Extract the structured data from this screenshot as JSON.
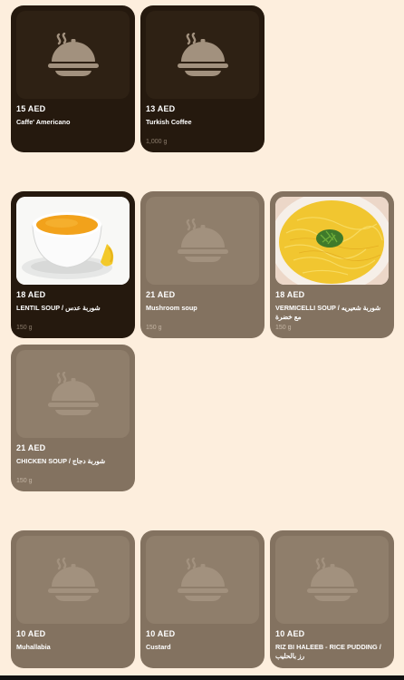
{
  "colors": {
    "page_bg": "#fdeedd",
    "card_dark": "#25190e",
    "card_muted": "#837260",
    "placeholder_icon": "#a2917e"
  },
  "sections": [
    {
      "items": [
        {
          "price": "15 AED",
          "name": "Caffe' Americano",
          "weight": "",
          "image": "placeholder-dish-icon"
        },
        {
          "price": "13 AED",
          "name": "Turkish Coffee",
          "weight": "1,000 g",
          "image": "placeholder-dish-icon"
        }
      ]
    },
    {
      "items": [
        {
          "price": "18 AED",
          "name": "LENTIL SOUP / شوربة عدس",
          "weight": "150 g",
          "image": "lentil-soup-photo"
        },
        {
          "price": "21 AED",
          "name": "Mushroom soup",
          "weight": "150 g",
          "image": "placeholder-dish-icon"
        },
        {
          "price": "18 AED",
          "name": "VERMICELLI SOUP / شوربة شعيريه مع خضرة",
          "weight": "150 g",
          "image": "vermicelli-soup-photo"
        },
        {
          "price": "21 AED",
          "name": "CHICKEN SOUP / شوربة دجاج",
          "weight": "150 g",
          "image": "placeholder-dish-icon"
        }
      ]
    },
    {
      "items": [
        {
          "price": "10 AED",
          "name": "Muhallabia",
          "weight": "",
          "image": "placeholder-dish-icon"
        },
        {
          "price": "10 AED",
          "name": "Custard",
          "weight": "",
          "image": "placeholder-dish-icon"
        },
        {
          "price": "10 AED",
          "name": "RIZ BI HALEEB - RICE PUDDING / رز بالحليب",
          "weight": "",
          "image": "placeholder-dish-icon"
        }
      ]
    }
  ]
}
